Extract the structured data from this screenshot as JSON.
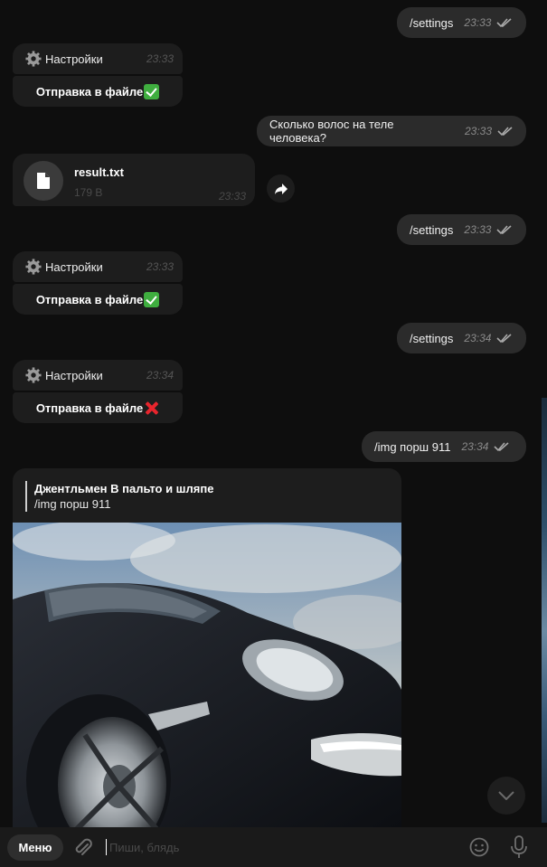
{
  "messages": {
    "m1": {
      "text": "/settings",
      "time": "23:33"
    },
    "m2": {
      "title": "Настройки",
      "time": "23:33",
      "button_label": "Отправка в файле"
    },
    "m3": {
      "text": "Сколько волос на теле человека?",
      "time": "23:33"
    },
    "m4": {
      "file_name": "result.txt",
      "file_size": "179 B",
      "time": "23:33"
    },
    "m5": {
      "text": "/settings",
      "time": "23:33"
    },
    "m6": {
      "title": "Настройки",
      "time": "23:33",
      "button_label": "Отправка в файле"
    },
    "m7": {
      "text": "/settings",
      "time": "23:34"
    },
    "m8": {
      "title": "Настройки",
      "time": "23:34",
      "button_label": "Отправка в файле"
    },
    "m9": {
      "text": "/img порш 911",
      "time": "23:34"
    },
    "m10": {
      "reply_author": "Джентльмен В пальто и шляпе",
      "reply_text": "/img порш 911"
    }
  },
  "composer": {
    "menu_label": "Меню",
    "placeholder": "Пиши, блядь"
  },
  "icons": {
    "gear": "gear-icon",
    "check": "white-check-mark-emoji",
    "cross": "cross-mark-emoji",
    "file": "file-icon",
    "forward": "forward-arrow-icon",
    "read": "double-check-icon",
    "attach": "paperclip-icon",
    "emoji": "smile-icon",
    "mic": "microphone-icon",
    "scroll": "chevron-down-icon"
  },
  "colors": {
    "background": "#0e0e0e",
    "outgoing_bubble": "#2b2b2b",
    "incoming_bubble": "#1d1d1d",
    "success": "#3fae3f",
    "error": "#e8252d"
  }
}
